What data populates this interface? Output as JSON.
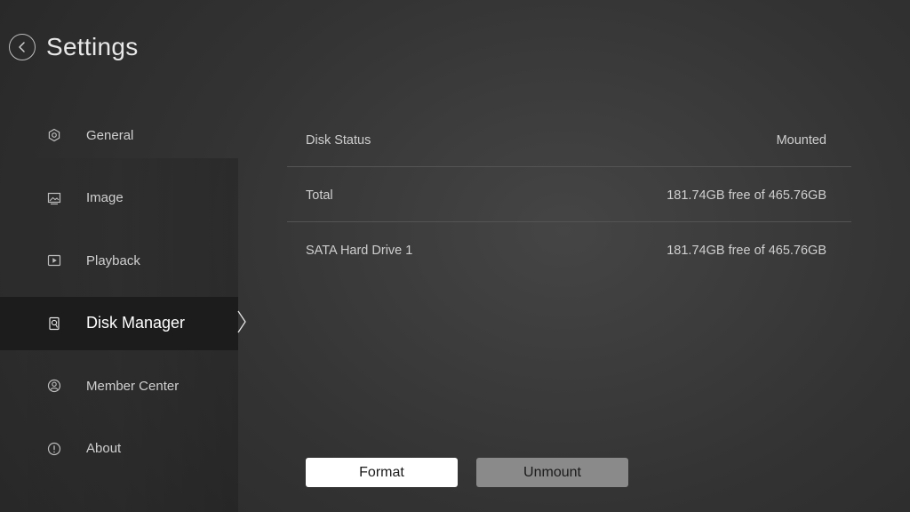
{
  "header": {
    "title": "Settings",
    "back_icon": "chevron-left-icon"
  },
  "sidebar": {
    "active": "Disk Manager",
    "items": [
      {
        "label": "General",
        "icon": "gear-icon"
      },
      {
        "label": "Image",
        "icon": "image-icon"
      },
      {
        "label": "Playback",
        "icon": "play-icon"
      },
      {
        "label": "Disk Manager",
        "icon": "disk-icon"
      },
      {
        "label": "Member Center",
        "icon": "user-icon"
      },
      {
        "label": "About",
        "icon": "info-icon"
      }
    ]
  },
  "disk": {
    "rows": [
      {
        "label": "Disk Status",
        "value": "Mounted"
      },
      {
        "label": "Total",
        "value": "181.74GB free of 465.76GB"
      },
      {
        "label": "SATA Hard Drive 1",
        "value": "181.74GB free of 465.76GB"
      }
    ]
  },
  "actions": {
    "format_label": "Format",
    "unmount_label": "Unmount"
  },
  "colors": {
    "background": "#333333",
    "active_item_bg": "#1c1c1c",
    "primary_button": "#ffffff",
    "secondary_button": "#8a8a8a"
  }
}
